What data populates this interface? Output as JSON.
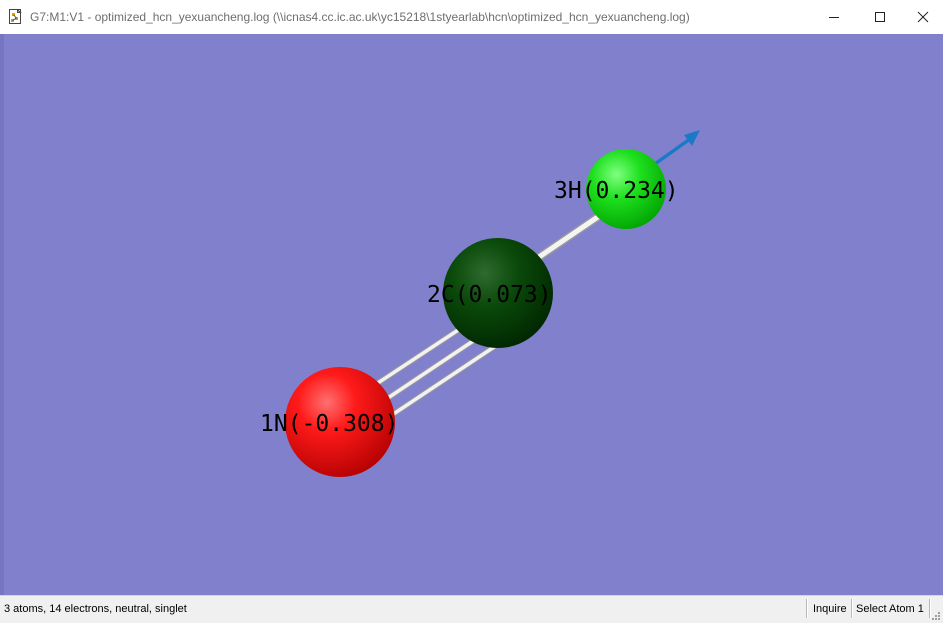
{
  "window": {
    "title": "G7:M1:V1 - optimized_hcn_yexuancheng.log (\\\\icnas4.cc.ic.ac.uk\\yc15218\\1styearlab\\hcn\\optimized_hcn_yexuancheng.log)",
    "app_icon": "gaussview-document-icon",
    "controls": {
      "minimize": "minimize-icon",
      "maximize": "maximize-icon",
      "close": "close-icon"
    }
  },
  "viewport": {
    "background_color": "#8080cc",
    "atoms": [
      {
        "index": 1,
        "element": "N",
        "label": "1N(-0.308)",
        "color": "#ff0000"
      },
      {
        "index": 2,
        "element": "C",
        "label": "2C(0.073)",
        "color": "#004000"
      },
      {
        "index": 3,
        "element": "H",
        "label": "3H(0.234)",
        "color": "#00e000"
      }
    ],
    "bonds": [
      {
        "from": 1,
        "to": 2,
        "order": 3
      },
      {
        "from": 2,
        "to": 3,
        "order": 1
      }
    ],
    "vector_arrow_color": "#1a7ac8"
  },
  "statusbar": {
    "molecule_info": "3 atoms, 14 electrons, neutral, singlet",
    "mode": "Inquire",
    "action": "Select Atom 1"
  }
}
